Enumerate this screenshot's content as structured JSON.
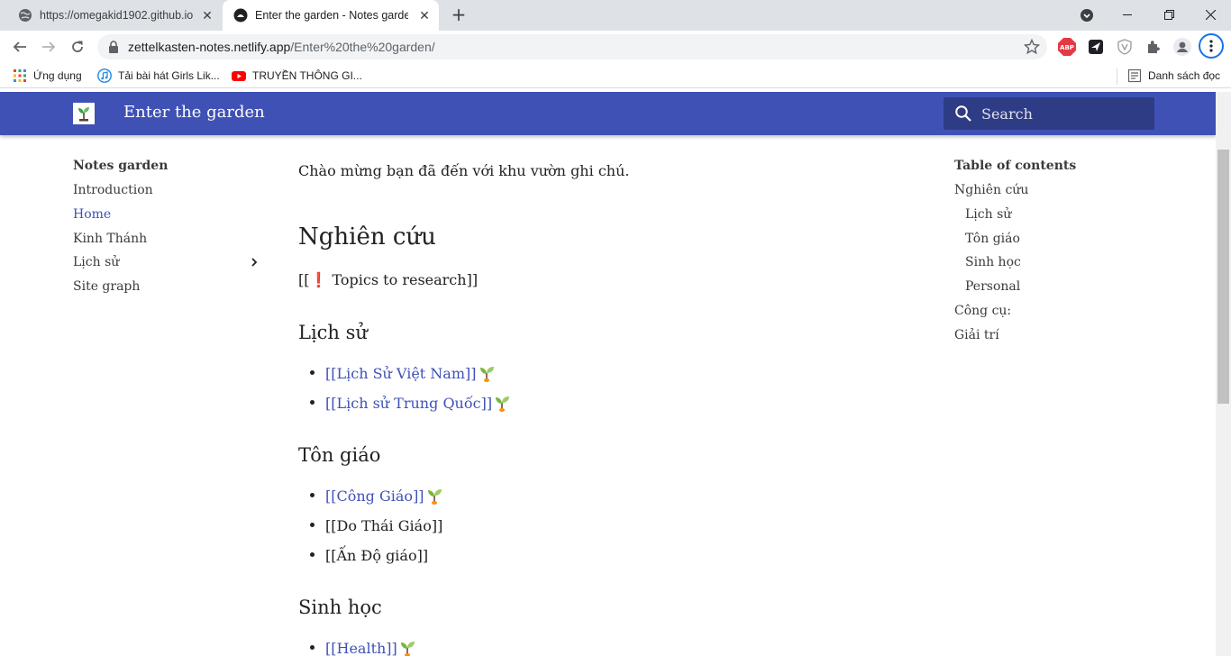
{
  "browser": {
    "tabs": [
      {
        "title": "https://omegakid1902.github.io/",
        "active": false
      },
      {
        "title": "Enter the garden - Notes garden",
        "active": true
      }
    ],
    "url_host": "zettelkasten-notes.netlify.app",
    "url_path": "/Enter%20the%20garden/",
    "bookmarks": [
      {
        "label": "Ứng dụng",
        "icon": "apps-grid-icon"
      },
      {
        "label": "Tải bài hát Girls Lik...",
        "icon": "music-icon"
      },
      {
        "label": "TRUYỀN THÔNG GI...",
        "icon": "youtube-icon"
      }
    ],
    "reading_list": "Danh sách đọc",
    "extensions": [
      "adblock-plus-icon",
      "send-icon",
      "shield-icon",
      "puzzle-icon",
      "profile-icon",
      "menu-icon"
    ]
  },
  "header": {
    "title": "Enter the garden",
    "search_placeholder": "Search"
  },
  "nav": {
    "title": "Notes garden",
    "items": [
      {
        "label": "Introduction",
        "active": false
      },
      {
        "label": "Home",
        "active": true
      },
      {
        "label": "Kinh Thánh",
        "active": false
      },
      {
        "label": "Lịch sử",
        "active": false,
        "expandable": true
      },
      {
        "label": "Site graph",
        "active": false
      }
    ]
  },
  "content": {
    "intro": "Chào mừng bạn đã đến với khu vườn ghi chú.",
    "research_heading": "Nghiên cứu",
    "research_para": "[[❗ Topics to research]]",
    "history_heading": "Lịch sử",
    "history_items": [
      {
        "text": "[[Lịch Sử Việt Nam]]",
        "link": true,
        "sprout": true
      },
      {
        "text": "[[Lịch sử Trung Quốc]]",
        "link": true,
        "sprout": true
      }
    ],
    "religion_heading": "Tôn giáo",
    "religion_items": [
      {
        "text": "[[Công Giáo]]",
        "link": true,
        "sprout": true
      },
      {
        "text": "[[Do Thái Giáo]]",
        "link": false,
        "sprout": false
      },
      {
        "text": "[[Ấn Độ giáo]]",
        "link": false,
        "sprout": false
      }
    ],
    "biology_heading": "Sinh học",
    "biology_items": [
      {
        "text": "[[Health]]",
        "link": true,
        "sprout": true
      }
    ]
  },
  "toc": {
    "title": "Table of contents",
    "items": [
      {
        "label": "Nghiên cứu",
        "level": 1
      },
      {
        "label": "Lịch sử",
        "level": 2
      },
      {
        "label": "Tôn giáo",
        "level": 2
      },
      {
        "label": "Sinh học",
        "level": 2
      },
      {
        "label": "Personal",
        "level": 2
      },
      {
        "label": "Công cụ:",
        "level": 1
      },
      {
        "label": "Giải trí",
        "level": 1
      }
    ]
  },
  "colors": {
    "header": "#3f51b5",
    "link": "#3f51b5",
    "text": "#222222"
  }
}
